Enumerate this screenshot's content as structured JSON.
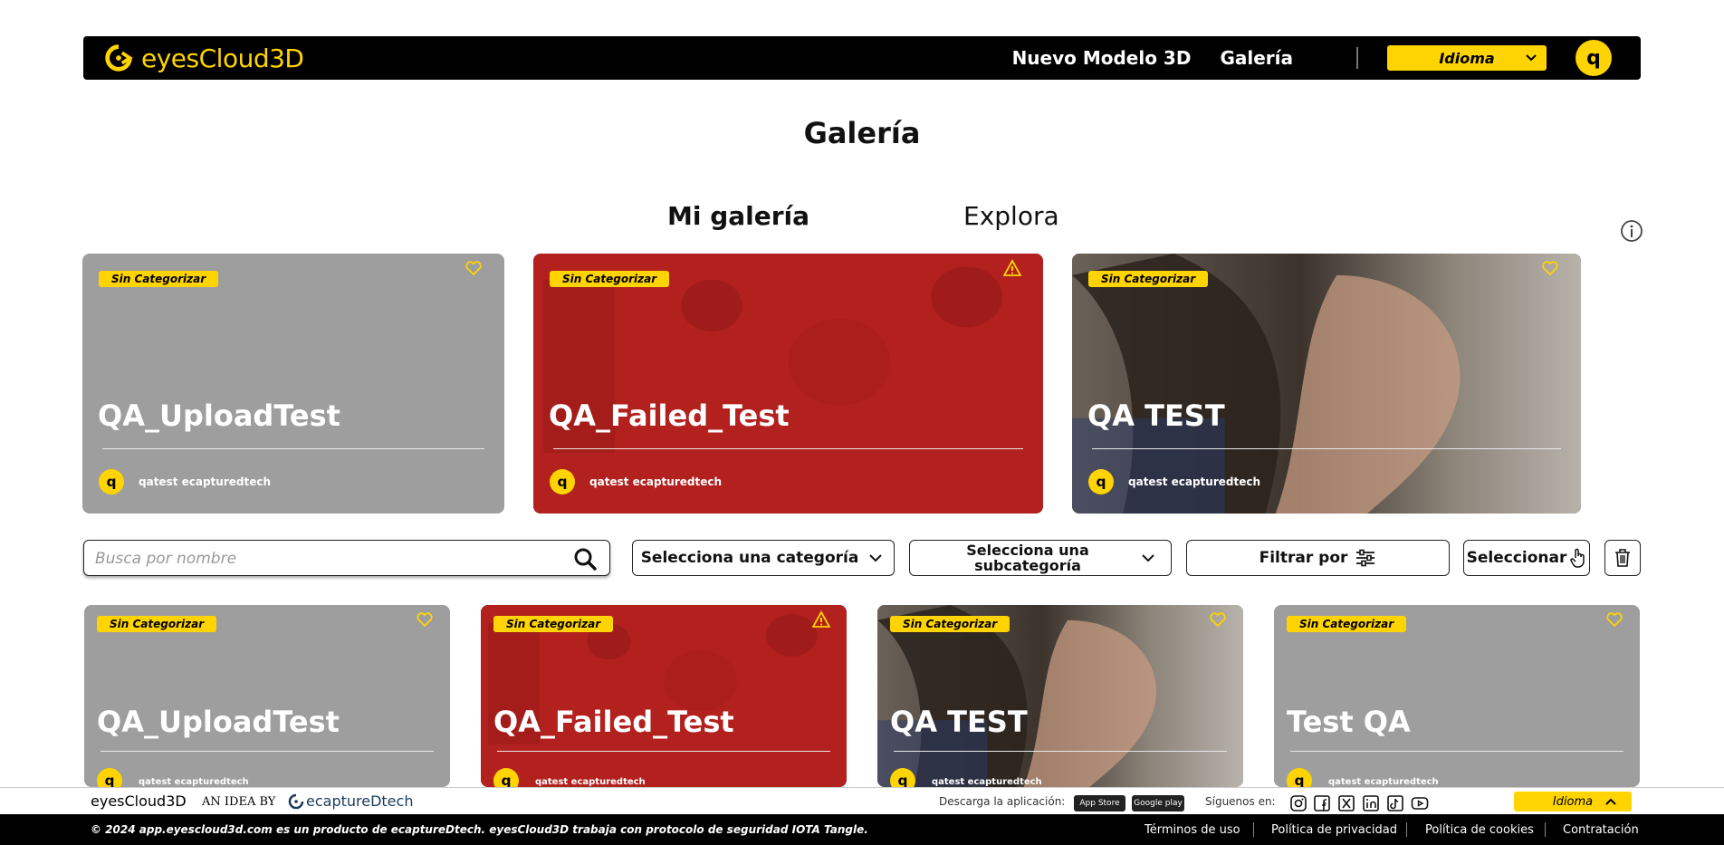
{
  "header": {
    "logo_text": "eyesCloud3D",
    "nav": {
      "new_model": "Nuevo Modelo 3D",
      "gallery": "Galería"
    },
    "language_label": "Idioma",
    "user_initial": "q",
    "accent_color": "#FFD400"
  },
  "page": {
    "title": "Galería"
  },
  "tabs": [
    {
      "label": "Mi galería",
      "active": true
    },
    {
      "label": "Explora",
      "active": false
    }
  ],
  "featured": [
    {
      "category": "Sin Categorizar",
      "title": "QA_UploadTest",
      "author": "qatest ecapturedtech",
      "author_initial": "q",
      "status_icon": "heart-icon",
      "style": "gray"
    },
    {
      "category": "Sin Categorizar",
      "title": "QA_Failed_Test",
      "author": "qatest ecapturedtech",
      "author_initial": "q",
      "status_icon": "warning-icon",
      "style": "red"
    },
    {
      "category": "Sin Categorizar",
      "title": "QA TEST",
      "author": "qatest ecapturedtech",
      "author_initial": "q",
      "status_icon": "heart-icon",
      "style": "photo"
    }
  ],
  "filters": {
    "search_placeholder": "Busca por nombre",
    "category": "Selecciona una categoría",
    "subcategory_line1": "Selecciona una",
    "subcategory_line2": "subcategoría",
    "filter_by": "Filtrar por",
    "select": "Seleccionar"
  },
  "grid": [
    {
      "category": "Sin Categorizar",
      "title": "QA_UploadTest",
      "author": "qatest ecapturedtech",
      "author_initial": "q",
      "status_icon": "heart-icon",
      "style": "gray"
    },
    {
      "category": "Sin Categorizar",
      "title": "QA_Failed_Test",
      "author": "qatest ecapturedtech",
      "author_initial": "q",
      "status_icon": "warning-icon",
      "style": "red"
    },
    {
      "category": "Sin Categorizar",
      "title": "QA TEST",
      "author": "qatest ecapturedtech",
      "author_initial": "q",
      "status_icon": "heart-icon",
      "style": "photo"
    },
    {
      "category": "Sin Categorizar",
      "title": "Test QA",
      "author": "qatest ecapturedtech",
      "author_initial": "q",
      "status_icon": "heart-icon",
      "style": "gray"
    }
  ],
  "footer": {
    "brand": "eyesCloud3D",
    "an_idea_by": "AN IDEA BY",
    "company": "ecaptureDtech",
    "download_label": "Descarga la aplicación:",
    "app_store": "App Store",
    "google_play": "Google play",
    "follow_label": "Síguenos en:",
    "language_label": "Idioma",
    "copyright": "© 2024 app.eyescloud3d.com es un producto de ecaptureDtech. eyesCloud3D trabaja con protocolo de seguridad IOTA Tangle.",
    "links": [
      "Términos de uso",
      "Política de privacidad",
      "Política de cookies",
      "Contratación"
    ]
  }
}
